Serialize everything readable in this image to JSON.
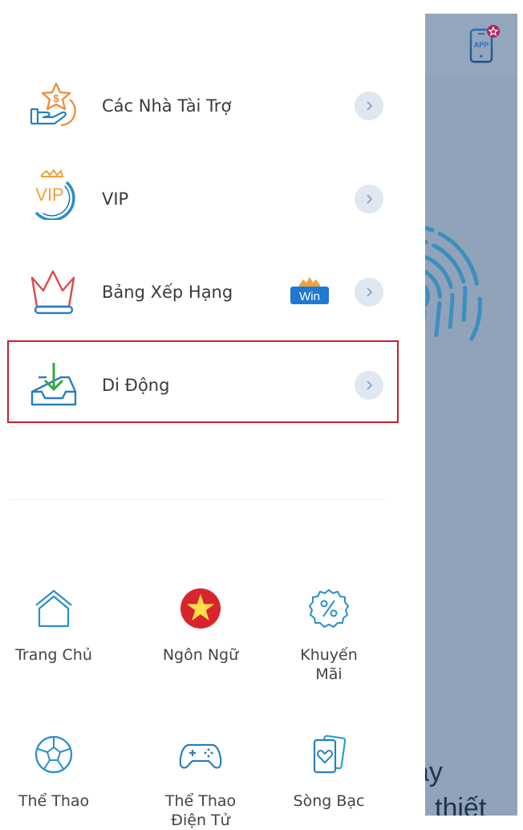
{
  "drawer": {
    "menu_items": [
      {
        "label": "Các Nhà Tài Trợ",
        "icon": "sponsor-hand-star-icon"
      },
      {
        "label": "VIP",
        "icon": "vip-crown-icon"
      },
      {
        "label": "Bảng Xếp Hạng",
        "icon": "crown-ranking-icon",
        "badge": "Win"
      },
      {
        "label": "Di Động",
        "icon": "download-tray-icon",
        "highlighted": true
      }
    ],
    "grid_items": [
      {
        "label": "Trang Chủ",
        "icon": "home-icon"
      },
      {
        "label": "Ngôn Ngữ",
        "icon": "vietnam-flag-icon"
      },
      {
        "label": "Khuyến Mãi",
        "icon": "promotion-percent-icon"
      },
      {
        "label": "Thể Thao",
        "icon": "soccer-ball-icon"
      },
      {
        "label": "Thể Thao Điện Tử",
        "icon": "gamepad-icon"
      },
      {
        "label": "Sòng Bạc",
        "icon": "playing-cards-icon"
      }
    ]
  },
  "background_page": {
    "app_button_label": "APP",
    "text_line_1": "ày",
    "text_line_2": "thiết"
  },
  "colors": {
    "highlight_border": "#c8202b",
    "overlay": "#90a3b8",
    "win_badge": "#1f78d1",
    "accent_orange": "#f0a03c"
  }
}
